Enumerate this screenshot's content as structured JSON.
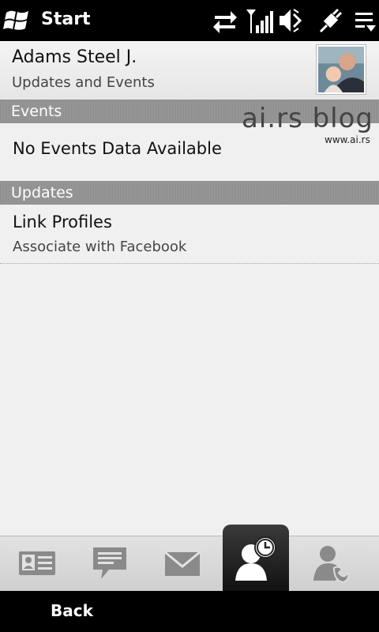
{
  "statusbar": {
    "title": "Start",
    "icons": [
      "windows-logo-icon",
      "data-sync-icon",
      "signal-strength-icon",
      "volume-icon",
      "connection-icon",
      "menu-icon"
    ]
  },
  "contact": {
    "name": "Adams Steel J.",
    "subtitle": "Updates and Events"
  },
  "events": {
    "header": "Events",
    "empty_text": "No Events Data Available"
  },
  "watermark": {
    "title": "ai.rs blog",
    "url": "www.ai.rs"
  },
  "updates": {
    "header": "Updates",
    "items": [
      {
        "title": "Link Profiles",
        "subtitle": "Associate with Facebook"
      }
    ]
  },
  "tabs": [
    {
      "icon": "contact-card-icon",
      "active": false
    },
    {
      "icon": "message-icon",
      "active": false
    },
    {
      "icon": "email-icon",
      "active": false
    },
    {
      "icon": "updates-events-icon",
      "active": true
    },
    {
      "icon": "call-history-icon",
      "active": false
    }
  ],
  "softkeys": {
    "left": "Back"
  },
  "colors": {
    "statusbar_bg": "#000000",
    "section_header_bg": "#999999",
    "page_bg": "#f0f0f0"
  }
}
